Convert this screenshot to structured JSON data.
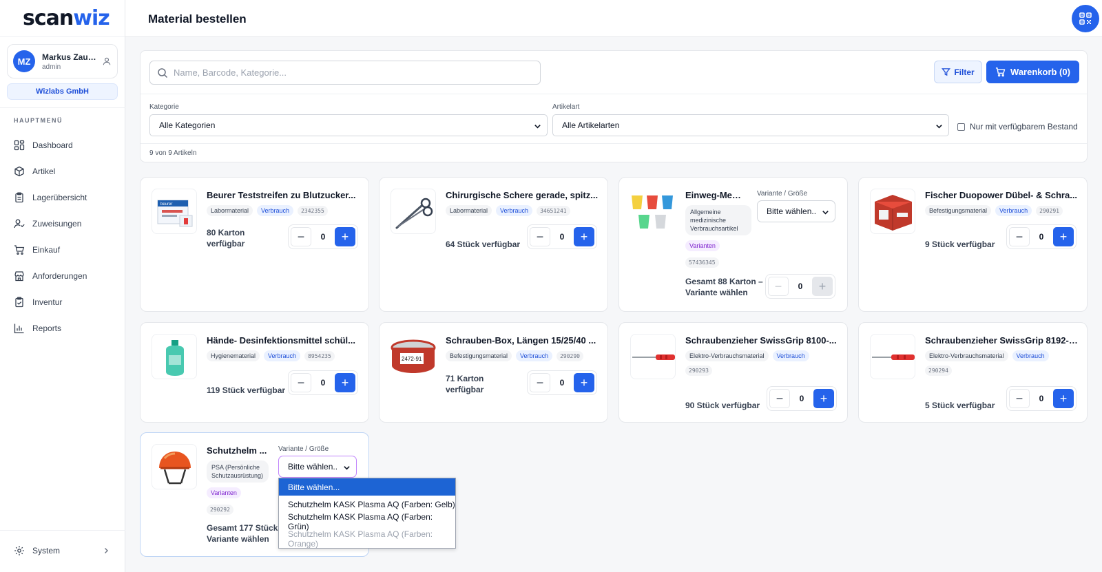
{
  "brand": {
    "part1": "scan",
    "part2": "wiz"
  },
  "user": {
    "initials": "MZ",
    "name": "Markus Zau…",
    "role": "admin",
    "company": "Wizlabs GmbH"
  },
  "sidebar": {
    "section_title": "HAUPTMENÜ",
    "items": [
      {
        "label": "Dashboard",
        "icon": "dashboard-icon"
      },
      {
        "label": "Artikel",
        "icon": "box-icon"
      },
      {
        "label": "Lagerübersicht",
        "icon": "clipboard-icon"
      },
      {
        "label": "Zuweisungen",
        "icon": "user-check-icon"
      },
      {
        "label": "Einkauf",
        "icon": "cart-icon"
      },
      {
        "label": "Anforderungen",
        "icon": "store-icon"
      },
      {
        "label": "Inventur",
        "icon": "clipboard-check-icon"
      },
      {
        "label": "Reports",
        "icon": "bar-chart-icon"
      }
    ],
    "system_label": "System"
  },
  "header": {
    "title": "Material bestellen"
  },
  "toolbar": {
    "search_placeholder": "Name, Barcode, Kategorie...",
    "filter_label": "Filter",
    "cart_label": "Warenkorb (0)",
    "category_label": "Kategorie",
    "category_value": "Alle Kategorien",
    "type_label": "Artikelart",
    "type_value": "Alle Artikelarten",
    "stock_only_label": "Nur mit verfügbarem Bestand",
    "count_text": "9 von 9 Artikeln"
  },
  "variant": {
    "label": "Variante / Größe",
    "placeholder": "Bitte wählen.."
  },
  "products": [
    {
      "title": "Beurer Teststreifen zu Blutzucker...",
      "category": "Labormaterial",
      "type": "Verbrauch",
      "code": "2342355",
      "avail": "80 Karton\nverfügbar",
      "qty": "0"
    },
    {
      "title": "Chirurgische Schere gerade, spitz...",
      "category": "Labormaterial",
      "type": "Verbrauch",
      "code": "34651241",
      "avail": "64 Stück verfügbar",
      "qty": "0"
    },
    {
      "title": "Einweg-Medi...",
      "category": "Allgemeine medizinische Verbrauchsartikel",
      "type": "Varianten",
      "code": "57436345",
      "avail": "Gesamt 88 Karton –\nVariante wählen",
      "qty": "0"
    },
    {
      "title": "Fischer Duopower Dübel- & Schra...",
      "category": "Befestigungsmaterial",
      "type": "Verbrauch",
      "code": "290291",
      "avail": "9 Stück verfügbar",
      "qty": "0"
    },
    {
      "title": "Hände- Desinfektionsmittel schül...",
      "category": "Hygienematerial",
      "type": "Verbrauch",
      "code": "8954235",
      "avail": "119 Stück verfügbar",
      "qty": "0"
    },
    {
      "title": "Schrauben-Box, Längen 15/25/40 ...",
      "category": "Befestigungsmaterial",
      "type": "Verbrauch",
      "code": "290290",
      "avail": "71 Karton\nverfügbar",
      "qty": "0"
    },
    {
      "title": "Schraubenzieher SwissGrip 8100-...",
      "category": "Elektro-Verbrauchsmaterial",
      "type": "Verbrauch",
      "code": "290293",
      "avail": "90 Stück verfügbar",
      "qty": "0"
    },
    {
      "title": "Schraubenzieher SwissGrip 8192-1...",
      "category": "Elektro-Verbrauchsmaterial",
      "type": "Verbrauch",
      "code": "290294",
      "avail": "5 Stück verfügbar",
      "qty": "0"
    },
    {
      "title": "Schutzhelm ...",
      "category": "PSA (Persönliche Schutzausrüstung)",
      "type": "Varianten",
      "code": "290292",
      "avail": "Gesamt 177 Stück –\nVariante wählen",
      "qty": "0"
    }
  ],
  "dropdown": {
    "options": [
      "Bitte wählen...",
      "Schutzhelm KASK Plasma AQ (Farben: Gelb)",
      "Schutzhelm KASK Plasma AQ (Farben: Grün)",
      "Schutzhelm KASK Plasma AQ (Farben: Orange)"
    ]
  },
  "colors": {
    "primary": "#2563eb",
    "variant_tag": "#7e22ce",
    "dropdown_selected": "#1d64d4"
  }
}
